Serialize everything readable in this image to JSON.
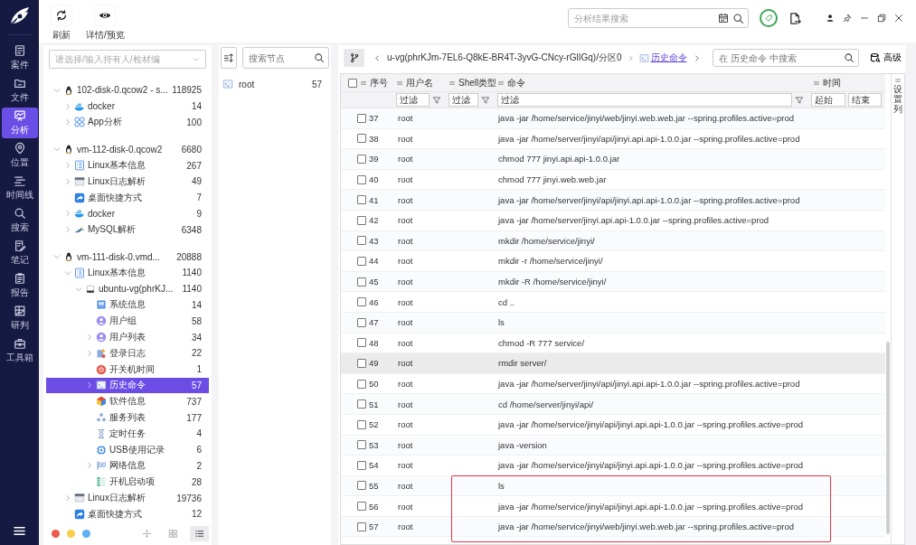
{
  "toolbar": {
    "buttons": [
      {
        "kind": "refresh",
        "label": "刷新"
      },
      {
        "kind": "preview",
        "label": "详情/预览"
      }
    ]
  },
  "global_search": {
    "placeholder": "分析结果搜索"
  },
  "nav": {
    "items": [
      {
        "kind": "case",
        "label": "案件",
        "selected": false
      },
      {
        "kind": "file",
        "label": "文件",
        "selected": false
      },
      {
        "kind": "analysis",
        "label": "分析",
        "selected": true
      },
      {
        "kind": "location",
        "label": "位置",
        "selected": false
      },
      {
        "kind": "timeline",
        "label": "时间线",
        "selected": false
      },
      {
        "kind": "search",
        "label": "搜索",
        "selected": false
      },
      {
        "kind": "note",
        "label": "笔记",
        "selected": false
      },
      {
        "kind": "report",
        "label": "报告",
        "selected": false
      },
      {
        "kind": "judge",
        "label": "研判",
        "selected": false
      },
      {
        "kind": "toolbox",
        "label": "工具箱",
        "selected": false
      }
    ]
  },
  "tree": {
    "picker": {
      "placeholder": "请选择/输入持有人/检材编"
    },
    "groups": [
      {
        "kind": "linux",
        "label": "102-disk-0.qcow2 - s...",
        "count": "118925",
        "expanded": true,
        "selected": false,
        "children": [
          {
            "kind": "docker",
            "label": "docker",
            "count": "14",
            "expanded": false,
            "selected": false
          },
          {
            "kind": "apps",
            "label": "App分析",
            "count": "100",
            "expanded": false,
            "selected": false
          }
        ]
      },
      {
        "kind": "linux",
        "label": "vm-112-disk-0.qcow2",
        "count": "6680",
        "expanded": true,
        "selected": false,
        "children": [
          {
            "kind": "list",
            "label": "Linux基本信息",
            "count": "267",
            "expanded": false,
            "selected": false
          },
          {
            "kind": "log",
            "label": "Linux日志解析",
            "count": "49",
            "expanded": false,
            "selected": false
          },
          {
            "kind": "shortcut",
            "label": "桌面快捷方式",
            "count": "7",
            "selected": false
          },
          {
            "kind": "docker",
            "label": "docker",
            "count": "9",
            "expanded": false,
            "selected": false
          },
          {
            "kind": "mysql",
            "label": "MySQL解析",
            "count": "6348",
            "expanded": false,
            "selected": false
          }
        ]
      },
      {
        "kind": "linux",
        "label": "vm-111-disk-0.vmd...",
        "count": "20888",
        "expanded": true,
        "selected": false,
        "children": [
          {
            "kind": "list",
            "label": "Linux基本信息",
            "count": "1140",
            "expanded": true,
            "selected": false,
            "children": [
              {
                "kind": "disk",
                "label": "ubuntu-vg(phrKJ...",
                "count": "1140",
                "expanded": true,
                "selected": false,
                "children": [
                  {
                    "kind": "info",
                    "label": "系统信息",
                    "count": "14",
                    "selected": false
                  },
                  {
                    "kind": "user",
                    "label": "用户组",
                    "count": "58",
                    "selected": false
                  },
                  {
                    "kind": "user",
                    "label": "用户列表",
                    "count": "34",
                    "expanded": false,
                    "selected": false
                  },
                  {
                    "kind": "login",
                    "label": "登录日志",
                    "count": "22",
                    "expanded": false,
                    "selected": false
                  },
                  {
                    "kind": "power",
                    "label": "开关机时间",
                    "count": "1",
                    "selected": false
                  },
                  {
                    "kind": "terminal",
                    "label": "历史命令",
                    "count": "57",
                    "expanded": false,
                    "selected": true
                  },
                  {
                    "kind": "package",
                    "label": "软件信息",
                    "count": "737",
                    "selected": false
                  },
                  {
                    "kind": "service",
                    "label": "服务列表",
                    "count": "177",
                    "selected": false
                  },
                  {
                    "kind": "timer",
                    "label": "定时任务",
                    "count": "4",
                    "selected": false
                  },
                  {
                    "kind": "usb",
                    "label": "USB使用记录",
                    "count": "6",
                    "selected": false
                  },
                  {
                    "kind": "network",
                    "label": "网络信息",
                    "count": "2",
                    "expanded": false,
                    "selected": false
                  },
                  {
                    "kind": "startup",
                    "label": "开机启动项",
                    "count": "28",
                    "selected": false
                  }
                ]
              }
            ]
          },
          {
            "kind": "log",
            "label": "Linux日志解析",
            "count": "19736",
            "expanded": false,
            "selected": false
          },
          {
            "kind": "shortcut",
            "label": "桌面快捷方式",
            "count": "12",
            "selected": false
          }
        ]
      }
    ],
    "legend": [
      {
        "color": "#ec5b4f"
      },
      {
        "color": "#f6cf4a"
      },
      {
        "color": "#5fb0f2"
      }
    ],
    "tools": [
      {
        "kind": "collapse",
        "selected": false
      },
      {
        "kind": "grid",
        "selected": false
      },
      {
        "kind": "list",
        "selected": true
      }
    ]
  },
  "nodes": {
    "search": {
      "placeholder": "搜索节点"
    },
    "items": [
      {
        "label": "root",
        "count": "57"
      }
    ]
  },
  "main": {
    "breadcrumb": {
      "path": "u-vg(phrKJm-7EL6-Q8kE-BR4T-3yvG-CNcy-rGlIGq)/分区0",
      "current": "历史命令"
    },
    "search": {
      "placeholder": "在 历史命令 中搜索"
    },
    "advanced": "高级",
    "table": {
      "columns": [
        {
          "label": "序号"
        },
        {
          "label": "用户名",
          "filter": "过滤"
        },
        {
          "label": "Shell类型",
          "filter": "过滤"
        },
        {
          "label": "命令",
          "filter": "过滤"
        },
        {
          "label": "时间",
          "filters": [
            "起始",
            "结束"
          ]
        }
      ],
      "column_settings": "设置列",
      "select_all": {
        "checked": false
      },
      "rows": [
        {
          "no": "37",
          "user": "root",
          "command": "java -jar /home/service/jinyi/web/jinyi.web.web.jar --spring.profiles.active=prod",
          "checked": false,
          "highlighted": false,
          "framed": false
        },
        {
          "no": "38",
          "user": "root",
          "command": "java -jar /home/server/jinyi/api/jinyi.api.api-1.0.0.jar --spring.profiles.active=prod",
          "checked": false,
          "highlighted": false,
          "framed": false
        },
        {
          "no": "39",
          "user": "root",
          "command": "chmod 777 jinyi.api.api-1.0.0.jar",
          "checked": false,
          "highlighted": false,
          "framed": false
        },
        {
          "no": "40",
          "user": "root",
          "command": "chmod 777 jinyi.web.web.jar",
          "checked": false,
          "highlighted": false,
          "framed": false
        },
        {
          "no": "41",
          "user": "root",
          "command": "java -jar /home/server/jinyi/api/jinyi.api.api-1.0.0.jar --spring.profiles.active=prod",
          "checked": false,
          "highlighted": false,
          "framed": false
        },
        {
          "no": "42",
          "user": "root",
          "command": "java -jar /home/server/jinyi.api.api-1.0.0.jar --spring.profiles.active=prod",
          "checked": false,
          "highlighted": false,
          "framed": false
        },
        {
          "no": "43",
          "user": "root",
          "command": "mkdir /home/service/jinyi/",
          "checked": false,
          "highlighted": false,
          "framed": false
        },
        {
          "no": "44",
          "user": "root",
          "command": "mkdir -r /home/service/jinyi/",
          "checked": false,
          "highlighted": false,
          "framed": false
        },
        {
          "no": "45",
          "user": "root",
          "command": "mkdir -R /home/service/jinyi/",
          "checked": false,
          "highlighted": false,
          "framed": false
        },
        {
          "no": "46",
          "user": "root",
          "command": "cd ..",
          "checked": false,
          "highlighted": false,
          "framed": false
        },
        {
          "no": "47",
          "user": "root",
          "command": "ls",
          "checked": false,
          "highlighted": false,
          "framed": false
        },
        {
          "no": "48",
          "user": "root",
          "command": "chmod -R 777 service/",
          "checked": false,
          "highlighted": false,
          "framed": false
        },
        {
          "no": "49",
          "user": "root",
          "command": "rmdir server/",
          "checked": false,
          "highlighted": true,
          "framed": false
        },
        {
          "no": "50",
          "user": "root",
          "command": "java -jar /home/server/jinyi/api/jinyi.api.api-1.0.0.jar --spring.profiles.active=prod",
          "checked": false,
          "highlighted": false,
          "framed": false
        },
        {
          "no": "51",
          "user": "root",
          "command": "cd /home/server/jinyi/api/",
          "checked": false,
          "highlighted": false,
          "framed": false
        },
        {
          "no": "52",
          "user": "root",
          "command": "java -jar /home/service/jinyi/api/jinyi.api.api-1.0.0.jar --spring.profiles.active=prod",
          "checked": false,
          "highlighted": false,
          "framed": false
        },
        {
          "no": "53",
          "user": "root",
          "command": "java -version",
          "checked": false,
          "highlighted": false,
          "framed": false
        },
        {
          "no": "54",
          "user": "root",
          "command": "java -jar /home/service/jinyi/api/jinyi.api.api-1.0.0.jar --spring.profiles.active=prod",
          "checked": false,
          "highlighted": false,
          "framed": false
        },
        {
          "no": "55",
          "user": "root",
          "command": "ls",
          "checked": false,
          "highlighted": false,
          "framed": true
        },
        {
          "no": "56",
          "user": "root",
          "command": "java -jar /home/service/jinyi/api/jinyi.api.api-1.0.0.jar --spring.profiles.active=prod",
          "checked": false,
          "highlighted": false,
          "framed": true
        },
        {
          "no": "57",
          "user": "root",
          "command": "java -jar /home/service/jinyi/web/jinyi.web.web.jar --spring.profiles.active=prod",
          "checked": false,
          "highlighted": false,
          "framed": true
        }
      ]
    }
  }
}
